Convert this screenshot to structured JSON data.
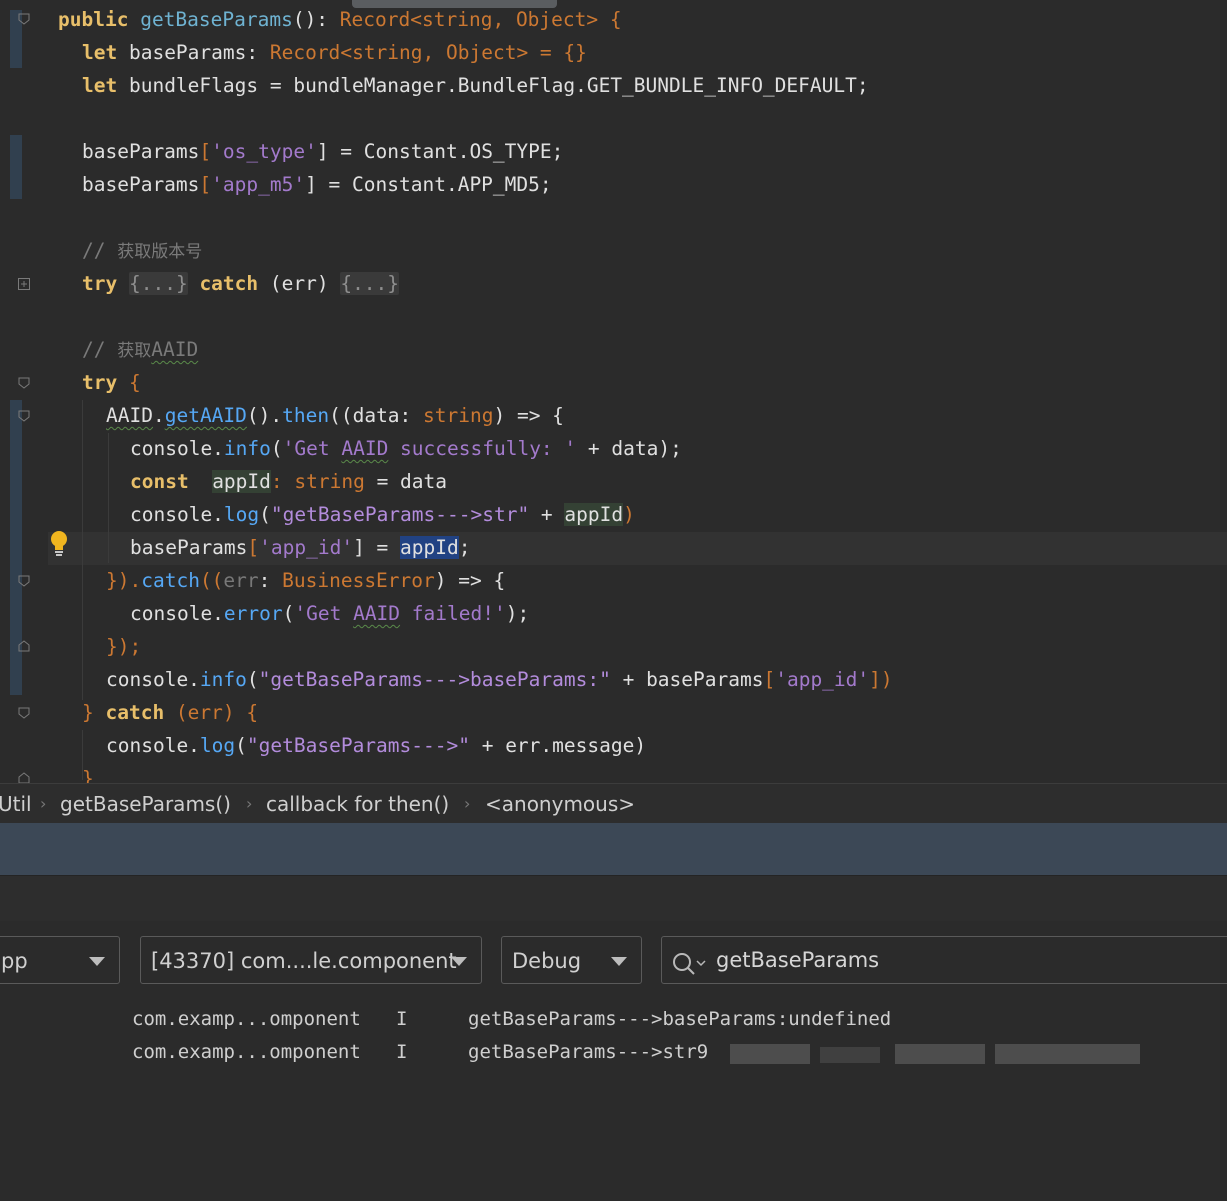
{
  "editor": {
    "lines": {
      "l1": {
        "k": "public",
        "fn": "getBaseParams",
        "p1": "(): ",
        "t1": "Record",
        "p2": "<",
        "t2": "string",
        ",": ", ",
        "t3": "Object",
        "p3": "> {"
      },
      "l2": {
        "k": "let",
        "a": " baseParams: ",
        "t1": "Record",
        "b": "<",
        "t2": "string",
        "c": ", ",
        "t3": "Object",
        "d": "> = {}"
      },
      "l3": {
        "k": "let",
        "a": " bundleFlags = bundleManager.BundleFlag.GET_BUNDLE_INFO_DEFAULT;"
      },
      "l5": {
        "a": "baseParams",
        "b": "[",
        "s": "'os_type'",
        "c": "] = Constant.OS_TYPE;"
      },
      "l6": {
        "a": "baseParams",
        "b": "[",
        "s": "'app_m5'",
        "c": "] = Constant.APP_MD5;"
      },
      "l8": {
        "c": "// ",
        "cn": "获取版本号"
      },
      "l9": {
        "k1": "try",
        "f1": "{...}",
        "k2": "catch",
        "a": " (err) ",
        "f2": "{...}"
      },
      "l11": {
        "c": "// ",
        "cn": "获取",
        "u": "AAID"
      },
      "l12": {
        "k": "try",
        "b": " {"
      },
      "l13": {
        "a": "AAID",
        "dot": ".",
        "fn1": "getAAID",
        "b": "().",
        "fn2": "then",
        "c": "((data: ",
        "t": "string",
        "d": ") => {"
      },
      "l14": {
        "a": "console.",
        "fn": "info",
        "b": "(",
        "s1": "'Get ",
        "su": "AAID",
        "s2": " successfully: '",
        "c": " + data);"
      },
      "l15": {
        "k": "const",
        "sp": "  ",
        "v": "appId",
        ":": ": ",
        "t": "string",
        "e": " = data"
      },
      "l16": {
        "a": "console.",
        "fn": "log",
        "b": "(",
        "s": "\"getBaseParams--->str\"",
        "c": " + ",
        "v": "appId",
        ")": ")"
      },
      "l17": {
        "a": "baseParams",
        "b": "[",
        "s": "'app_id'",
        "c": "] = ",
        "v": "appId",
        ";": ";"
      },
      "l18": {
        "a": "}).",
        "fn": "catch",
        "b": "((",
        "v": "err",
        ":": ": ",
        "t": "BusinessError",
        "c": ") => {"
      },
      "l19": {
        "a": "console.",
        "fn": "error",
        "b": "(",
        "s1": "'Get ",
        "su": "AAID",
        "s2": " failed!'",
        "c": ");"
      },
      "l20": {
        "a": "});"
      },
      "l21": {
        "a": "console.",
        "fn": "info",
        "b": "(",
        "s": "\"getBaseParams--->baseParams:\"",
        "c": " + baseParams",
        "d": "[",
        "s2": "'app_id'",
        "e": "])"
      },
      "l22": {
        "a": "} ",
        "k": "catch",
        "b": " (err) {"
      },
      "l23": {
        "a": "console.",
        "fn": "log",
        "b": "(",
        "s": "\"getBaseParams--->\"",
        "c": " + err.message)"
      },
      "l24": {
        "a": "}"
      }
    }
  },
  "breadcrumb": {
    "c0": "Util",
    "c1": "getBaseParams()",
    "c2": "callback for then()",
    "c3": "<anonymous>",
    "sep": "›"
  },
  "logcat": {
    "device": "pp",
    "process": "[43370] com....le.component",
    "level": "Debug",
    "search": "getBaseParams",
    "rows": [
      {
        "pkg": "com.examp...omponent",
        "lvl": "I",
        "msg": "getBaseParams--->baseParams:undefined"
      },
      {
        "pkg": "com.examp...omponent",
        "lvl": "I",
        "msg": "getBaseParams--->str9"
      }
    ]
  },
  "colors": {
    "accent": "#214283",
    "toolbar": "#3c4856",
    "bulb": "#f0b51f"
  }
}
